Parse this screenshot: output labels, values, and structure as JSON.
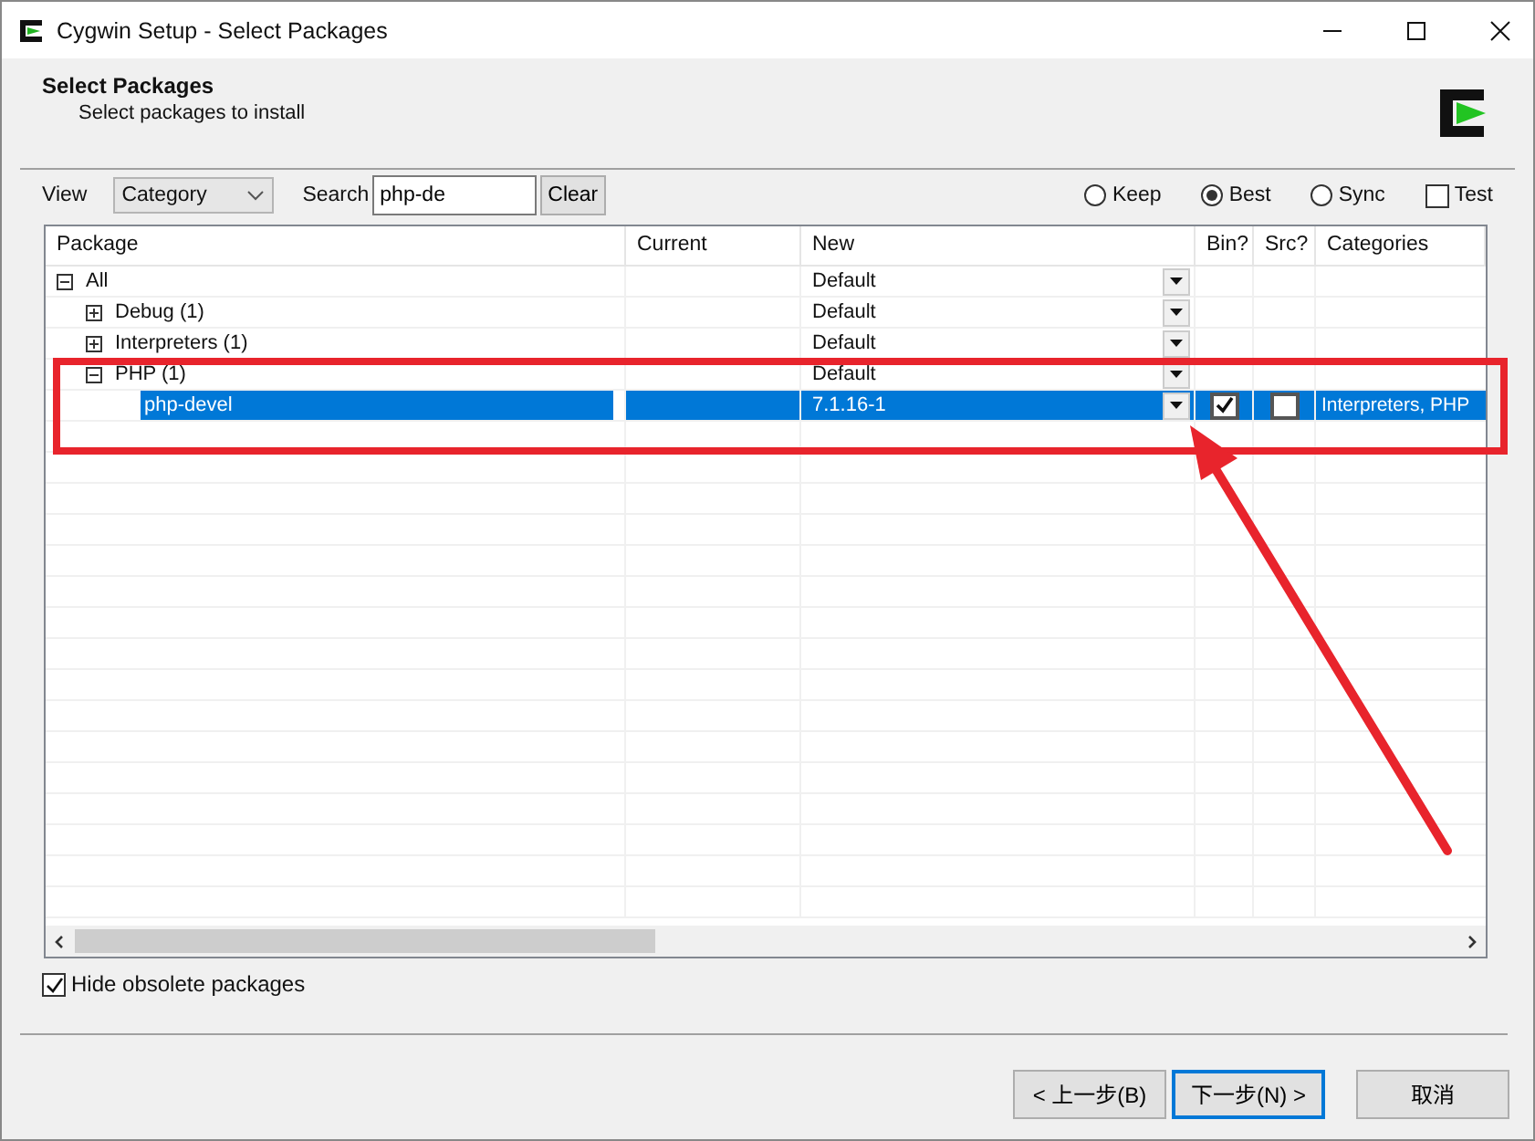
{
  "window": {
    "title": "Cygwin Setup - Select Packages"
  },
  "header": {
    "title": "Select Packages",
    "subtitle": "Select packages to install"
  },
  "toolbar": {
    "view_label": "View",
    "view_value": "Category",
    "search_label": "Search",
    "search_value": "php-de",
    "clear_button": "Clear",
    "modes": [
      {
        "label": "Keep",
        "selected": false
      },
      {
        "label": "Best",
        "selected": true
      },
      {
        "label": "Sync",
        "selected": false
      }
    ],
    "test": {
      "label": "Test",
      "checked": false
    }
  },
  "table": {
    "columns": [
      "Package",
      "Current",
      "New",
      "Bin?",
      "Src?",
      "Categories"
    ],
    "rows": [
      {
        "name": "All",
        "expanded": true,
        "new": "Default",
        "selected": false,
        "children": [
          {
            "name": "Debug (1)",
            "expanded": false,
            "new": "Default",
            "selected": false
          },
          {
            "name": "Interpreters (1)",
            "expanded": false,
            "new": "Default",
            "selected": false
          },
          {
            "name": "PHP (1)",
            "expanded": true,
            "new": "Default",
            "selected": false,
            "children": [
              {
                "name": "php-devel",
                "new": "7.1.16-1",
                "bin": {
                  "checked": true
                },
                "src": {
                  "checked": false
                },
                "categories": "Interpreters, PHP",
                "selected": true
              }
            ]
          }
        ]
      }
    ]
  },
  "hide_obsolete": {
    "label": "Hide obsolete packages",
    "checked": true
  },
  "buttons": [
    {
      "label": "< 上一步(B)",
      "default": false
    },
    {
      "label": "下一步(N) >",
      "default": true
    },
    {
      "label": "取消",
      "default": false
    }
  ]
}
